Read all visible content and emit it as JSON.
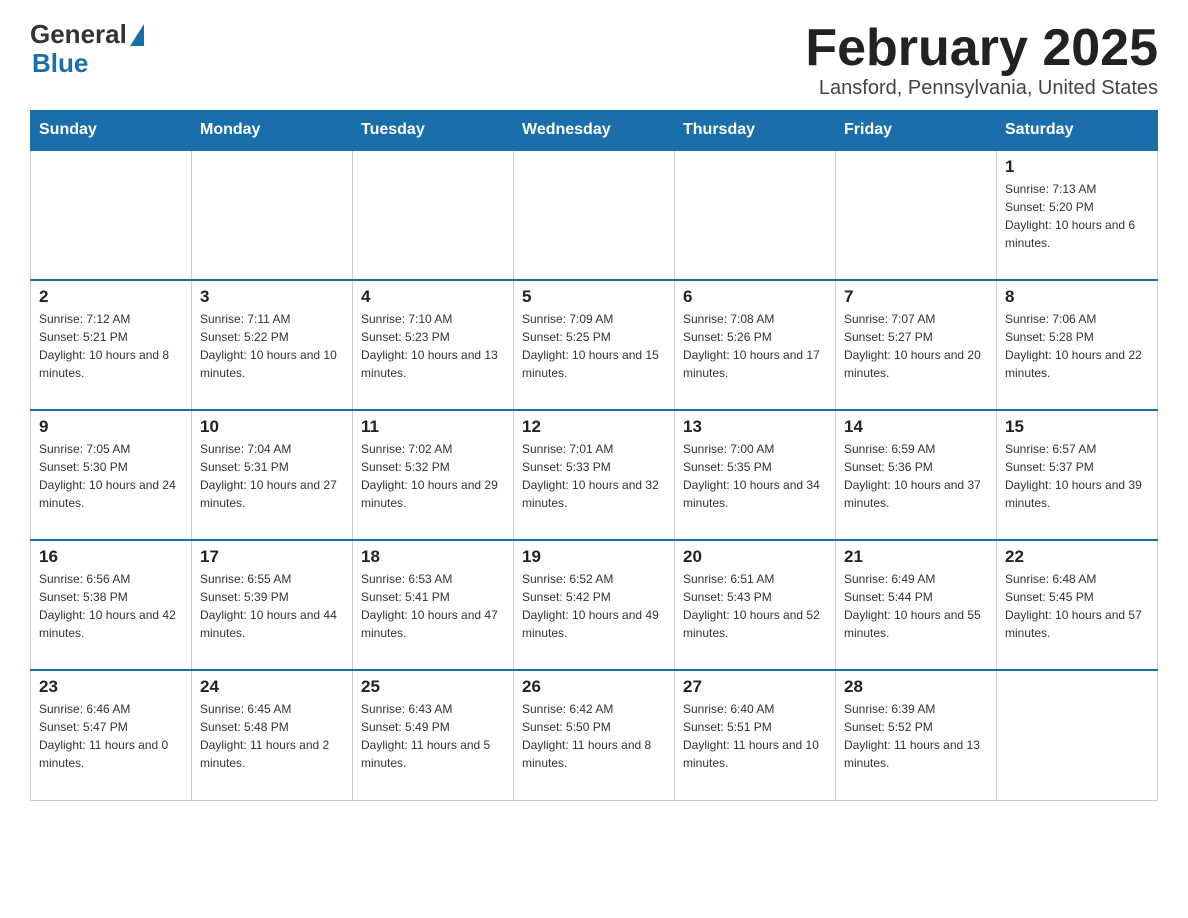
{
  "header": {
    "logo_general": "General",
    "logo_blue": "Blue",
    "month_title": "February 2025",
    "location": "Lansford, Pennsylvania, United States"
  },
  "weekdays": [
    "Sunday",
    "Monday",
    "Tuesday",
    "Wednesday",
    "Thursday",
    "Friday",
    "Saturday"
  ],
  "weeks": [
    [
      {
        "day": "",
        "info": ""
      },
      {
        "day": "",
        "info": ""
      },
      {
        "day": "",
        "info": ""
      },
      {
        "day": "",
        "info": ""
      },
      {
        "day": "",
        "info": ""
      },
      {
        "day": "",
        "info": ""
      },
      {
        "day": "1",
        "info": "Sunrise: 7:13 AM\nSunset: 5:20 PM\nDaylight: 10 hours and 6 minutes."
      }
    ],
    [
      {
        "day": "2",
        "info": "Sunrise: 7:12 AM\nSunset: 5:21 PM\nDaylight: 10 hours and 8 minutes."
      },
      {
        "day": "3",
        "info": "Sunrise: 7:11 AM\nSunset: 5:22 PM\nDaylight: 10 hours and 10 minutes."
      },
      {
        "day": "4",
        "info": "Sunrise: 7:10 AM\nSunset: 5:23 PM\nDaylight: 10 hours and 13 minutes."
      },
      {
        "day": "5",
        "info": "Sunrise: 7:09 AM\nSunset: 5:25 PM\nDaylight: 10 hours and 15 minutes."
      },
      {
        "day": "6",
        "info": "Sunrise: 7:08 AM\nSunset: 5:26 PM\nDaylight: 10 hours and 17 minutes."
      },
      {
        "day": "7",
        "info": "Sunrise: 7:07 AM\nSunset: 5:27 PM\nDaylight: 10 hours and 20 minutes."
      },
      {
        "day": "8",
        "info": "Sunrise: 7:06 AM\nSunset: 5:28 PM\nDaylight: 10 hours and 22 minutes."
      }
    ],
    [
      {
        "day": "9",
        "info": "Sunrise: 7:05 AM\nSunset: 5:30 PM\nDaylight: 10 hours and 24 minutes."
      },
      {
        "day": "10",
        "info": "Sunrise: 7:04 AM\nSunset: 5:31 PM\nDaylight: 10 hours and 27 minutes."
      },
      {
        "day": "11",
        "info": "Sunrise: 7:02 AM\nSunset: 5:32 PM\nDaylight: 10 hours and 29 minutes."
      },
      {
        "day": "12",
        "info": "Sunrise: 7:01 AM\nSunset: 5:33 PM\nDaylight: 10 hours and 32 minutes."
      },
      {
        "day": "13",
        "info": "Sunrise: 7:00 AM\nSunset: 5:35 PM\nDaylight: 10 hours and 34 minutes."
      },
      {
        "day": "14",
        "info": "Sunrise: 6:59 AM\nSunset: 5:36 PM\nDaylight: 10 hours and 37 minutes."
      },
      {
        "day": "15",
        "info": "Sunrise: 6:57 AM\nSunset: 5:37 PM\nDaylight: 10 hours and 39 minutes."
      }
    ],
    [
      {
        "day": "16",
        "info": "Sunrise: 6:56 AM\nSunset: 5:38 PM\nDaylight: 10 hours and 42 minutes."
      },
      {
        "day": "17",
        "info": "Sunrise: 6:55 AM\nSunset: 5:39 PM\nDaylight: 10 hours and 44 minutes."
      },
      {
        "day": "18",
        "info": "Sunrise: 6:53 AM\nSunset: 5:41 PM\nDaylight: 10 hours and 47 minutes."
      },
      {
        "day": "19",
        "info": "Sunrise: 6:52 AM\nSunset: 5:42 PM\nDaylight: 10 hours and 49 minutes."
      },
      {
        "day": "20",
        "info": "Sunrise: 6:51 AM\nSunset: 5:43 PM\nDaylight: 10 hours and 52 minutes."
      },
      {
        "day": "21",
        "info": "Sunrise: 6:49 AM\nSunset: 5:44 PM\nDaylight: 10 hours and 55 minutes."
      },
      {
        "day": "22",
        "info": "Sunrise: 6:48 AM\nSunset: 5:45 PM\nDaylight: 10 hours and 57 minutes."
      }
    ],
    [
      {
        "day": "23",
        "info": "Sunrise: 6:46 AM\nSunset: 5:47 PM\nDaylight: 11 hours and 0 minutes."
      },
      {
        "day": "24",
        "info": "Sunrise: 6:45 AM\nSunset: 5:48 PM\nDaylight: 11 hours and 2 minutes."
      },
      {
        "day": "25",
        "info": "Sunrise: 6:43 AM\nSunset: 5:49 PM\nDaylight: 11 hours and 5 minutes."
      },
      {
        "day": "26",
        "info": "Sunrise: 6:42 AM\nSunset: 5:50 PM\nDaylight: 11 hours and 8 minutes."
      },
      {
        "day": "27",
        "info": "Sunrise: 6:40 AM\nSunset: 5:51 PM\nDaylight: 11 hours and 10 minutes."
      },
      {
        "day": "28",
        "info": "Sunrise: 6:39 AM\nSunset: 5:52 PM\nDaylight: 11 hours and 13 minutes."
      },
      {
        "day": "",
        "info": ""
      }
    ]
  ]
}
